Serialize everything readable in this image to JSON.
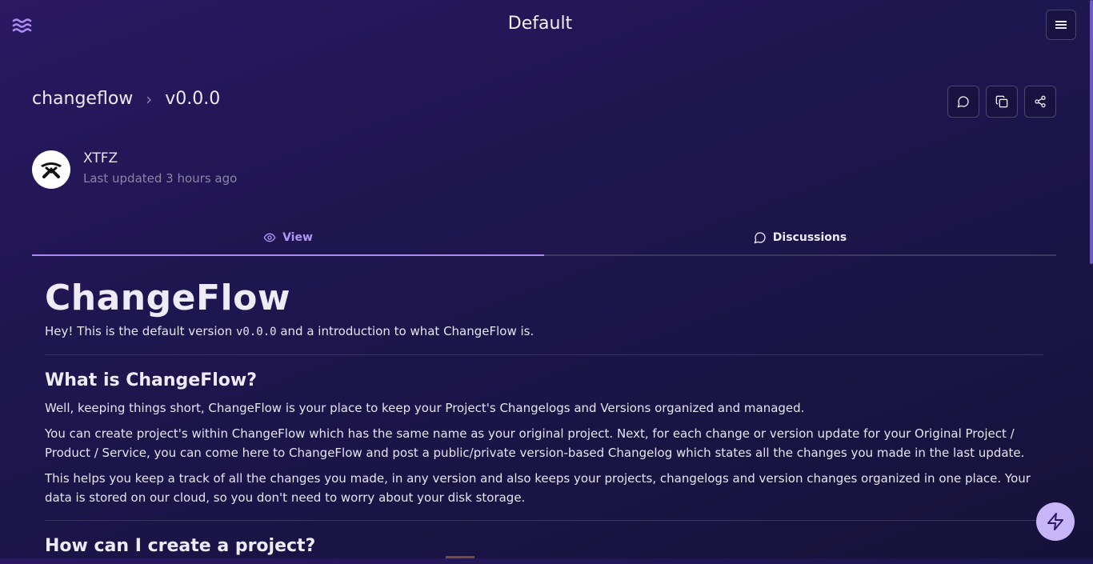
{
  "header": {
    "title": "Default"
  },
  "breadcrumb": {
    "project": "changeflow",
    "separator": "›",
    "version": "v0.0.0"
  },
  "author": {
    "name": "XTFZ",
    "updated": "Last updated 3 hours ago"
  },
  "tabs": {
    "view": "View",
    "discussions": "Discussions"
  },
  "article": {
    "title": "ChangeFlow",
    "intro_pre": "Hey! This is the default version ",
    "intro_code": "v0.0.0",
    "intro_post": " and a introduction to what ChangeFlow is.",
    "h2_what": "What is ChangeFlow?",
    "p1": "Well, keeping things short, ChangeFlow is your place to keep your Project's Changelogs and Versions organized and managed.",
    "p2": "You can create project's within ChangeFlow which has the same name as your original project. Next, for each change or version update for your Original Project / Product / Service, you can come here to ChangeFlow and post a public/private version-based Changelog which states all the changes you made in the last update.",
    "p3": "This helps you keep a track of all the changes you made, in any version and also keeps your projects, changelogs and version changes organized in one place. Your data is stored on our cloud, so you don't need to worry about your disk storage.",
    "h2_how": "How can I create a project?"
  },
  "icons": {
    "logo": "waves-icon",
    "menu": "hamburger-menu-icon",
    "comment": "message-circle-icon",
    "copy": "copy-icon",
    "share": "share-icon",
    "view": "eye-icon",
    "discussions": "message-circle-icon",
    "fab": "lightning-bolt-icon"
  },
  "colors": {
    "accent": "#a98bf0",
    "fab": "#c7b6f7",
    "background": "#1f1650"
  }
}
